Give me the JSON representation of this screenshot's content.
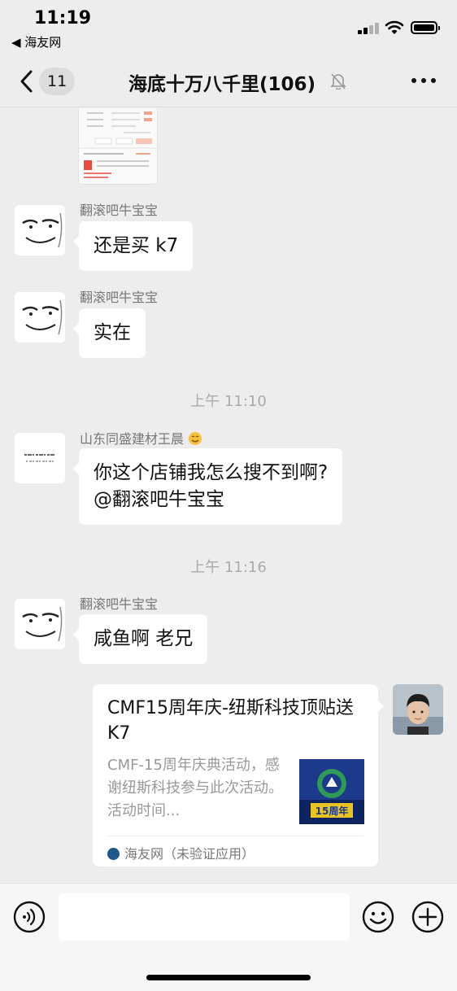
{
  "status_bar": {
    "time": "11:19",
    "back_app": "◀ 海友网"
  },
  "nav": {
    "unread_count": "11",
    "title": "海底十万八千里(106)",
    "back_icon": "chevron-left-icon",
    "mute_icon": "bell-off-icon",
    "more_icon": "more-dots-icon"
  },
  "messages": [
    {
      "sender": "翻滚吧牛宝宝",
      "text": "还是买 k7"
    },
    {
      "sender": "翻滚吧牛宝宝",
      "text": "实在"
    },
    {
      "timestamp": "上午 11:10"
    },
    {
      "sender": "山东同盛建材王晨",
      "text_line1": "你这个店铺我怎么搜不到啊?",
      "text_line2": "@翻滚吧牛宝宝"
    },
    {
      "timestamp": "上午 11:16"
    },
    {
      "sender": "翻滚吧牛宝宝",
      "text": "咸鱼啊 老兄"
    }
  ],
  "link_card": {
    "title": "CMF15周年庆-纽斯科技顶贴送 K7",
    "description": "CMF-15周年庆典活动，感谢纽斯科技参与此次活动。活动时间...",
    "source": "海友网（未验证应用）",
    "thumb_label": "15周年"
  },
  "input_bar": {
    "placeholder": "",
    "voice_icon": "voice-icon",
    "emoji_icon": "emoji-icon",
    "plus_icon": "plus-circle-icon"
  },
  "colors": {
    "background": "#ededed",
    "bubble": "#ffffff",
    "meta_text": "#777777"
  }
}
